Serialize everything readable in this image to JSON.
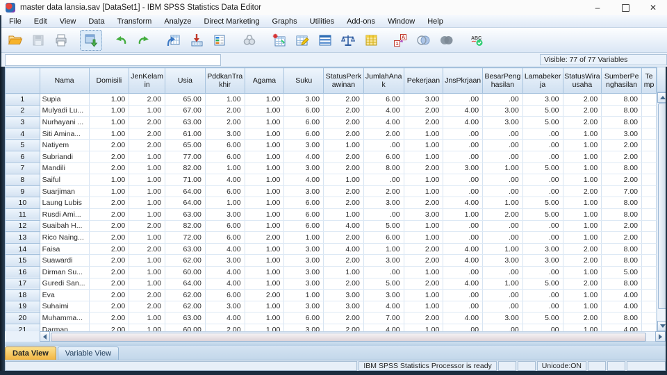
{
  "window": {
    "title": "master data lansia.sav [DataSet1] - IBM SPSS Statistics Data Editor",
    "controls": {
      "minimize": "–",
      "close": "✕"
    }
  },
  "menubar": {
    "items": [
      "File",
      "Edit",
      "View",
      "Data",
      "Transform",
      "Analyze",
      "Direct Marketing",
      "Graphs",
      "Utilities",
      "Add-ons",
      "Window",
      "Help"
    ]
  },
  "toolbar": {
    "icons": [
      "open-data-icon",
      "save-icon",
      "print-icon",
      "recall-dialogs-icon",
      "undo-icon",
      "redo-icon",
      "goto-case-icon",
      "goto-variable-icon",
      "variables-icon",
      "find-icon",
      "insert-cases-icon",
      "insert-variable-icon",
      "split-file-icon",
      "weight-cases-icon",
      "select-cases-icon",
      "value-labels-icon",
      "use-variable-sets-icon",
      "show-all-variables-icon",
      "spell-check-icon"
    ]
  },
  "cellbar": {
    "cell_ref_value": "",
    "visible_label": "Visible: 77 of 77 Variables"
  },
  "grid": {
    "columns": [
      "Nama",
      "Domisili",
      "JenKelamin",
      "Usia",
      "PddkanTrakhir",
      "Agama",
      "Suku",
      "StatusPerkawinan",
      "JumlahAnak",
      "Pekerjaan",
      "JnsPkrjaan",
      "BesarPenghasilan",
      "Lamabekerja",
      "StatusWirausaha",
      "SumberPenghasilan",
      "Temp"
    ],
    "rows": [
      [
        1,
        "Supia",
        "1.00",
        "2.00",
        "65.00",
        "1.00",
        "1.00",
        "3.00",
        "2.00",
        "6.00",
        "3.00",
        ".00",
        ".00",
        "3.00",
        "2.00",
        "8.00"
      ],
      [
        2,
        "Mulyadi Lu...",
        "1.00",
        "1.00",
        "67.00",
        "2.00",
        "1.00",
        "6.00",
        "2.00",
        "4.00",
        "2.00",
        "4.00",
        "3.00",
        "5.00",
        "2.00",
        "8.00"
      ],
      [
        3,
        "Nurhayani ...",
        "1.00",
        "2.00",
        "63.00",
        "2.00",
        "1.00",
        "6.00",
        "2.00",
        "4.00",
        "2.00",
        "4.00",
        "3.00",
        "5.00",
        "2.00",
        "8.00"
      ],
      [
        4,
        "Siti Amina...",
        "1.00",
        "2.00",
        "61.00",
        "3.00",
        "1.00",
        "6.00",
        "2.00",
        "2.00",
        "1.00",
        ".00",
        ".00",
        ".00",
        "1.00",
        "3.00"
      ],
      [
        5,
        "Natiyem",
        "2.00",
        "2.00",
        "65.00",
        "6.00",
        "1.00",
        "3.00",
        "1.00",
        ".00",
        "1.00",
        ".00",
        ".00",
        ".00",
        "1.00",
        "2.00"
      ],
      [
        6,
        "Subriandi",
        "2.00",
        "1.00",
        "77.00",
        "6.00",
        "1.00",
        "4.00",
        "2.00",
        "6.00",
        "1.00",
        ".00",
        ".00",
        ".00",
        "1.00",
        "2.00"
      ],
      [
        7,
        "Mandili",
        "2.00",
        "1.00",
        "82.00",
        "1.00",
        "1.00",
        "3.00",
        "2.00",
        "8.00",
        "2.00",
        "3.00",
        "1.00",
        "5.00",
        "1.00",
        "8.00"
      ],
      [
        8,
        "Saiful",
        "1.00",
        "1.00",
        "71.00",
        "4.00",
        "1.00",
        "4.00",
        "1.00",
        ".00",
        "1.00",
        ".00",
        ".00",
        ".00",
        "1.00",
        "2.00"
      ],
      [
        9,
        "Suarjiman",
        "1.00",
        "1.00",
        "64.00",
        "6.00",
        "1.00",
        "3.00",
        "2.00",
        "2.00",
        "1.00",
        ".00",
        ".00",
        ".00",
        "2.00",
        "7.00"
      ],
      [
        10,
        "Laung Lubis",
        "2.00",
        "1.00",
        "64.00",
        "1.00",
        "1.00",
        "6.00",
        "2.00",
        "3.00",
        "2.00",
        "4.00",
        "1.00",
        "5.00",
        "1.00",
        "8.00"
      ],
      [
        11,
        "Rusdi Ami...",
        "2.00",
        "1.00",
        "63.00",
        "3.00",
        "1.00",
        "6.00",
        "1.00",
        ".00",
        "3.00",
        "1.00",
        "2.00",
        "5.00",
        "1.00",
        "8.00"
      ],
      [
        12,
        "Suaibah H...",
        "2.00",
        "2.00",
        "82.00",
        "6.00",
        "1.00",
        "6.00",
        "4.00",
        "5.00",
        "1.00",
        ".00",
        ".00",
        ".00",
        "1.00",
        "2.00"
      ],
      [
        13,
        "Rico Naing...",
        "2.00",
        "1.00",
        "72.00",
        "6.00",
        "2.00",
        "1.00",
        "2.00",
        "6.00",
        "1.00",
        ".00",
        ".00",
        ".00",
        "1.00",
        "2.00"
      ],
      [
        14,
        "Faisa",
        "2.00",
        "2.00",
        "63.00",
        "4.00",
        "1.00",
        "3.00",
        "4.00",
        "1.00",
        "2.00",
        "4.00",
        "1.00",
        "3.00",
        "2.00",
        "8.00"
      ],
      [
        15,
        "Suawardi",
        "2.00",
        "1.00",
        "62.00",
        "3.00",
        "1.00",
        "3.00",
        "2.00",
        "3.00",
        "2.00",
        "4.00",
        "3.00",
        "3.00",
        "2.00",
        "8.00"
      ],
      [
        16,
        "Dirman Su...",
        "2.00",
        "1.00",
        "60.00",
        "4.00",
        "1.00",
        "3.00",
        "1.00",
        ".00",
        "1.00",
        ".00",
        ".00",
        ".00",
        "1.00",
        "5.00"
      ],
      [
        17,
        "Guredi San...",
        "2.00",
        "1.00",
        "64.00",
        "4.00",
        "1.00",
        "3.00",
        "2.00",
        "5.00",
        "2.00",
        "4.00",
        "1.00",
        "5.00",
        "2.00",
        "8.00"
      ],
      [
        18,
        "Eva",
        "2.00",
        "2.00",
        "62.00",
        "6.00",
        "2.00",
        "1.00",
        "3.00",
        "3.00",
        "1.00",
        ".00",
        ".00",
        ".00",
        "1.00",
        "4.00"
      ],
      [
        19,
        "Suhaimi",
        "2.00",
        "2.00",
        "62.00",
        "3.00",
        "1.00",
        "3.00",
        "3.00",
        "4.00",
        "1.00",
        ".00",
        ".00",
        ".00",
        "1.00",
        "4.00"
      ],
      [
        20,
        "Muhamma...",
        "2.00",
        "1.00",
        "63.00",
        "4.00",
        "1.00",
        "6.00",
        "2.00",
        "7.00",
        "2.00",
        "4.00",
        "3.00",
        "5.00",
        "2.00",
        "8.00"
      ],
      [
        21,
        "Darman",
        "2.00",
        "1.00",
        "60.00",
        "2.00",
        "1.00",
        "3.00",
        "2.00",
        "4.00",
        "1.00",
        ".00",
        ".00",
        ".00",
        "1.00",
        "4.00"
      ]
    ]
  },
  "tabs": {
    "data_view": "Data View",
    "variable_view": "Variable View",
    "active": "Data View"
  },
  "statusbar": {
    "message": "IBM SPSS Statistics Processor is ready",
    "unicode": "Unicode:ON"
  },
  "colors": {
    "accent_tab": "#f2b644",
    "header_blue": "#d0e0f1",
    "grid_line": "#d7e4f2"
  }
}
